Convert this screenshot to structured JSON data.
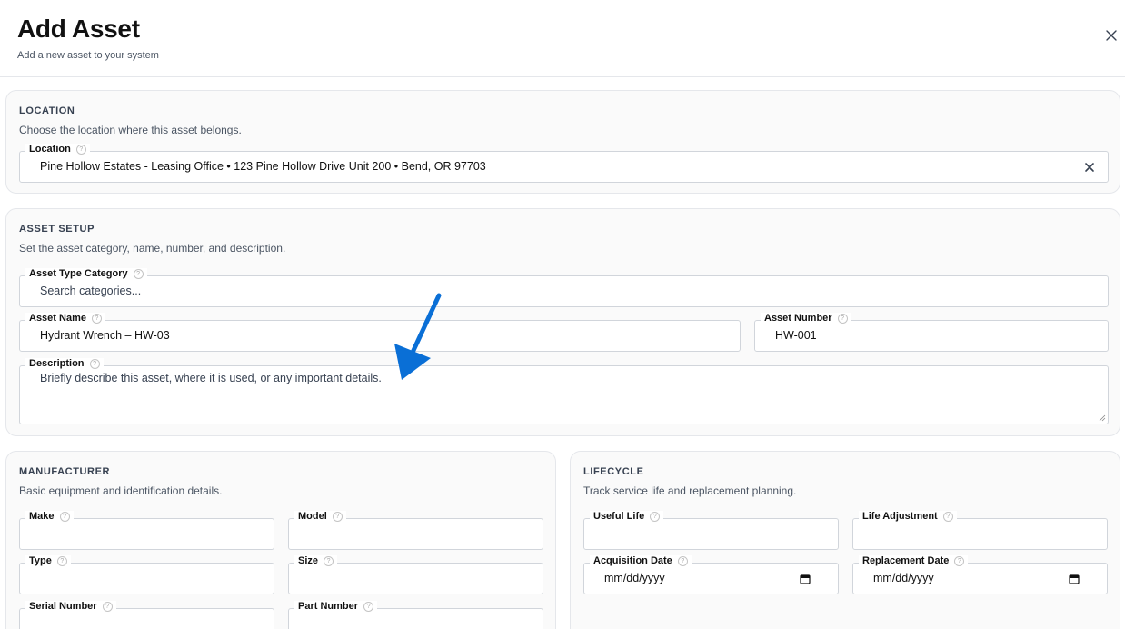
{
  "header": {
    "title": "Add Asset",
    "subtitle": "Add a new asset to your system"
  },
  "location": {
    "heading": "LOCATION",
    "description": "Choose the location where this asset belongs.",
    "field_label": "Location",
    "value": "Pine Hollow Estates - Leasing Office • 123 Pine Hollow Drive Unit 200 • Bend, OR 97703"
  },
  "asset_setup": {
    "heading": "ASSET SETUP",
    "description": "Set the asset category, name, number, and description.",
    "category_label": "Asset Type Category",
    "category_placeholder": "Search categories...",
    "name_label": "Asset Name",
    "name_value": "Hydrant Wrench – HW-03",
    "number_label": "Asset Number",
    "number_value": "HW-001",
    "description_label": "Description",
    "description_placeholder": "Briefly describe this asset, where it is used, or any important details."
  },
  "manufacturer": {
    "heading": "MANUFACTURER",
    "description": "Basic equipment and identification details.",
    "make_label": "Make",
    "model_label": "Model",
    "type_label": "Type",
    "size_label": "Size",
    "serial_label": "Serial Number",
    "part_label": "Part Number"
  },
  "lifecycle": {
    "heading": "LIFECYCLE",
    "description": "Track service life and replacement planning.",
    "useful_life_label": "Useful Life",
    "life_adjustment_label": "Life Adjustment",
    "acquisition_label": "Acquisition Date",
    "acquisition_value": "mm/dd/yyyy",
    "replacement_label": "Replacement Date",
    "replacement_value": "mm/dd/yyyy"
  },
  "help_glyph": "?",
  "colors": {
    "annotation_arrow": "#0a6fd6",
    "border": "#d1d5db",
    "card_bg": "#fafafa"
  }
}
